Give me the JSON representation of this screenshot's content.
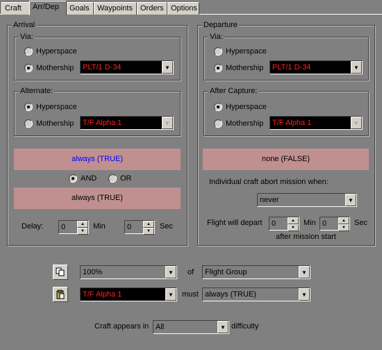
{
  "tabs": [
    "Craft",
    "Arr/Dep",
    "Goals",
    "Waypoints",
    "Orders",
    "Options"
  ],
  "arrival": {
    "title": "Arrival",
    "via": {
      "title": "Via:",
      "hyperspace": "Hyperspace",
      "mothership": "Mothership",
      "selected": "mothership",
      "mothership_value": "PLT/1 D-34"
    },
    "alternate": {
      "title": "Alternate:",
      "hyperspace": "Hyperspace",
      "mothership": "Mothership",
      "selected": "hyperspace",
      "mothership_value": "T/F Alpha 1"
    },
    "condition1": "always (TRUE)",
    "and_label": "AND",
    "or_label": "OR",
    "logic_selected": "AND",
    "condition2": "always (TRUE)",
    "delay_label": "Delay:",
    "delay_min": "0",
    "min_label": "Min",
    "delay_sec": "0",
    "sec_label": "Sec"
  },
  "departure": {
    "title": "Departure",
    "via": {
      "title": "Via:",
      "hyperspace": "Hyperspace",
      "mothership": "Mothership",
      "selected": "mothership",
      "mothership_value": "PLT/1 D-34"
    },
    "after_capture": {
      "title": "After Capture:",
      "hyperspace": "Hyperspace",
      "mothership": "Mothership",
      "selected": "hyperspace",
      "mothership_value": "T/F Alpha 1"
    },
    "condition": "none (FALSE)",
    "abort_label": "Individual craft abort mission when:",
    "abort_value": "never",
    "depart_label": "Flight will depart",
    "depart_min": "0",
    "min_label": "Min",
    "depart_sec": "0",
    "sec_label": "Sec",
    "after_start": "after mission start"
  },
  "bottom": {
    "percent_value": "100%",
    "of_label": "of",
    "group_value": "Flight Group",
    "craft_value": "T/F Alpha 1",
    "must_label": "must",
    "must_value": "always (TRUE)",
    "appears_label": "Craft appears in",
    "difficulty_value": "All",
    "difficulty_label": "difficulty"
  },
  "colors": {
    "background": "#808080",
    "condition_box": "#c09090",
    "craft_text": "#ff2020",
    "condition_highlight": "#0000ff"
  }
}
